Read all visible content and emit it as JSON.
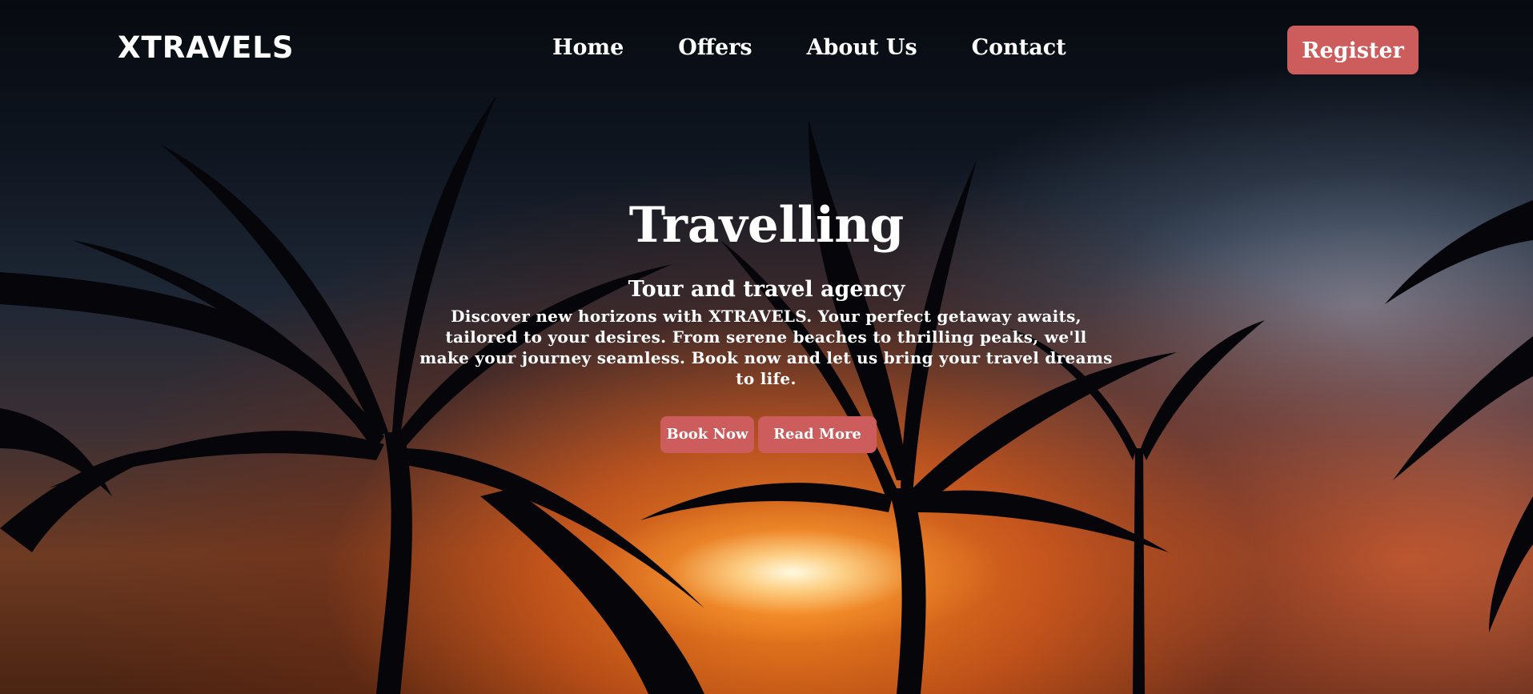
{
  "brand": {
    "name": "XTRAVELS"
  },
  "nav": {
    "items": [
      {
        "label": "Home"
      },
      {
        "label": "Offers"
      },
      {
        "label": "About Us"
      },
      {
        "label": "Contact"
      }
    ],
    "register_label": "Register"
  },
  "hero": {
    "title": "Travelling",
    "subtitle": "Tour and travel agency",
    "description": "Discover new horizons with XTRAVELS. Your perfect getaway awaits, tailored to your desires. From serene beaches to thrilling peaks, we'll make your journey seamless. Book now and let us bring your travel dreams to life.",
    "book_label": "Book Now",
    "read_label": "Read More",
    "background": "sunset-palm-trees-image"
  },
  "colors": {
    "accent": "#cd5c5c",
    "text": "#ffffff"
  }
}
